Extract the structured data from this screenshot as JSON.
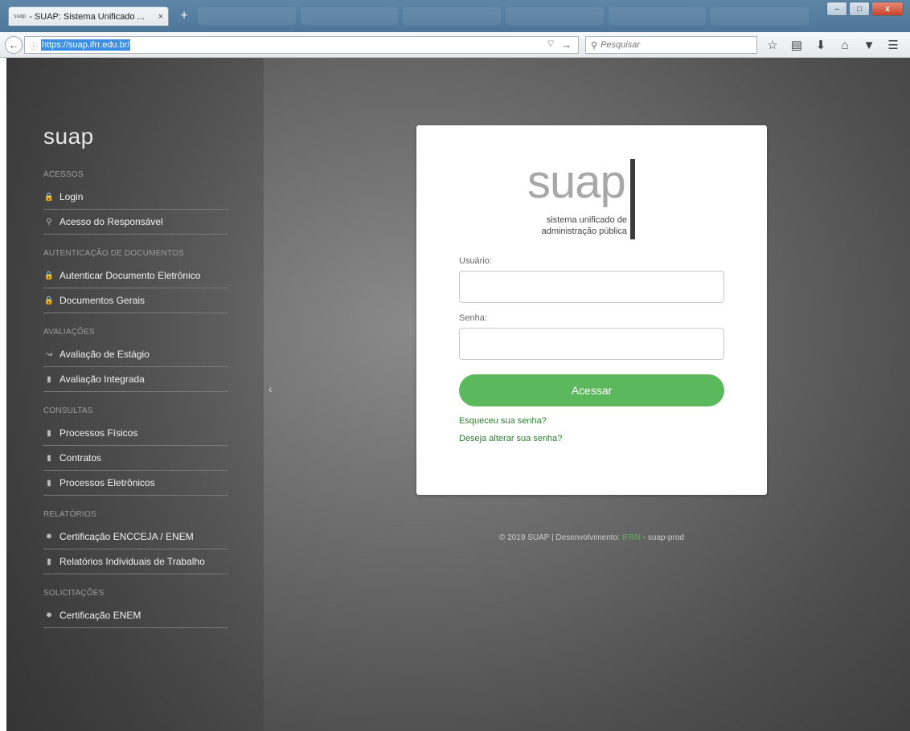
{
  "browser": {
    "tab_favicon": "suap",
    "tab_title": "- SUAP: Sistema Unificado ...",
    "tab_close": "×",
    "new_tab": "+",
    "url": "https://suap.ifrr.edu.br/",
    "search_placeholder": "Pesquisar",
    "window_minimize": "–",
    "window_maximize": "□",
    "window_close": "x"
  },
  "sidebar": {
    "logo": "suap",
    "sections": [
      {
        "title": "ACESSOS",
        "items": [
          {
            "label": "Login",
            "icon": "lock-icon"
          },
          {
            "label": "Acesso do Responsável",
            "icon": "key-icon"
          }
        ]
      },
      {
        "title": "AUTENTICAÇÃO DE DOCUMENTOS",
        "items": [
          {
            "label": "Autenticar Documento Eletrônico",
            "icon": "lock-icon"
          },
          {
            "label": "Documentos Gerais",
            "icon": "lock-icon"
          }
        ]
      },
      {
        "title": "AVALIAÇÕES",
        "items": [
          {
            "label": "Avaliação de Estágio",
            "icon": "chart-icon"
          },
          {
            "label": "Avaliação Integrada",
            "icon": "file-icon"
          }
        ]
      },
      {
        "title": "CONSULTAS",
        "items": [
          {
            "label": "Processos Físicos",
            "icon": "file-icon"
          },
          {
            "label": "Contratos",
            "icon": "file-icon"
          },
          {
            "label": "Processos Eletrônicos",
            "icon": "file-icon"
          }
        ]
      },
      {
        "title": "RELATÓRIOS",
        "items": [
          {
            "label": "Certificação ENCCEJA / ENEM",
            "icon": "certificate-icon"
          },
          {
            "label": "Relatórios Individuais de Trabalho",
            "icon": "file-icon"
          }
        ]
      },
      {
        "title": "SOLICITAÇÕES",
        "items": [
          {
            "label": "Certificação ENEM",
            "icon": "certificate-icon"
          }
        ]
      }
    ]
  },
  "login": {
    "brand_word": "suap",
    "brand_line1": "sistema unificado de",
    "brand_line2": "administração pública",
    "username_label": "Usuário:",
    "username_value": "",
    "password_label": "Senha:",
    "password_value": "",
    "submit_label": "Acessar",
    "forgot_link": "Esqueceu sua senha?",
    "change_link": "Deseja alterar sua senha?"
  },
  "footer": {
    "prefix": "© 2019 SUAP | Desenvolvimento: ",
    "org": "IFRN",
    "suffix": " - suap-prod"
  },
  "colors": {
    "accent_green": "#5cb85c",
    "link_green": "#2e7d32"
  }
}
